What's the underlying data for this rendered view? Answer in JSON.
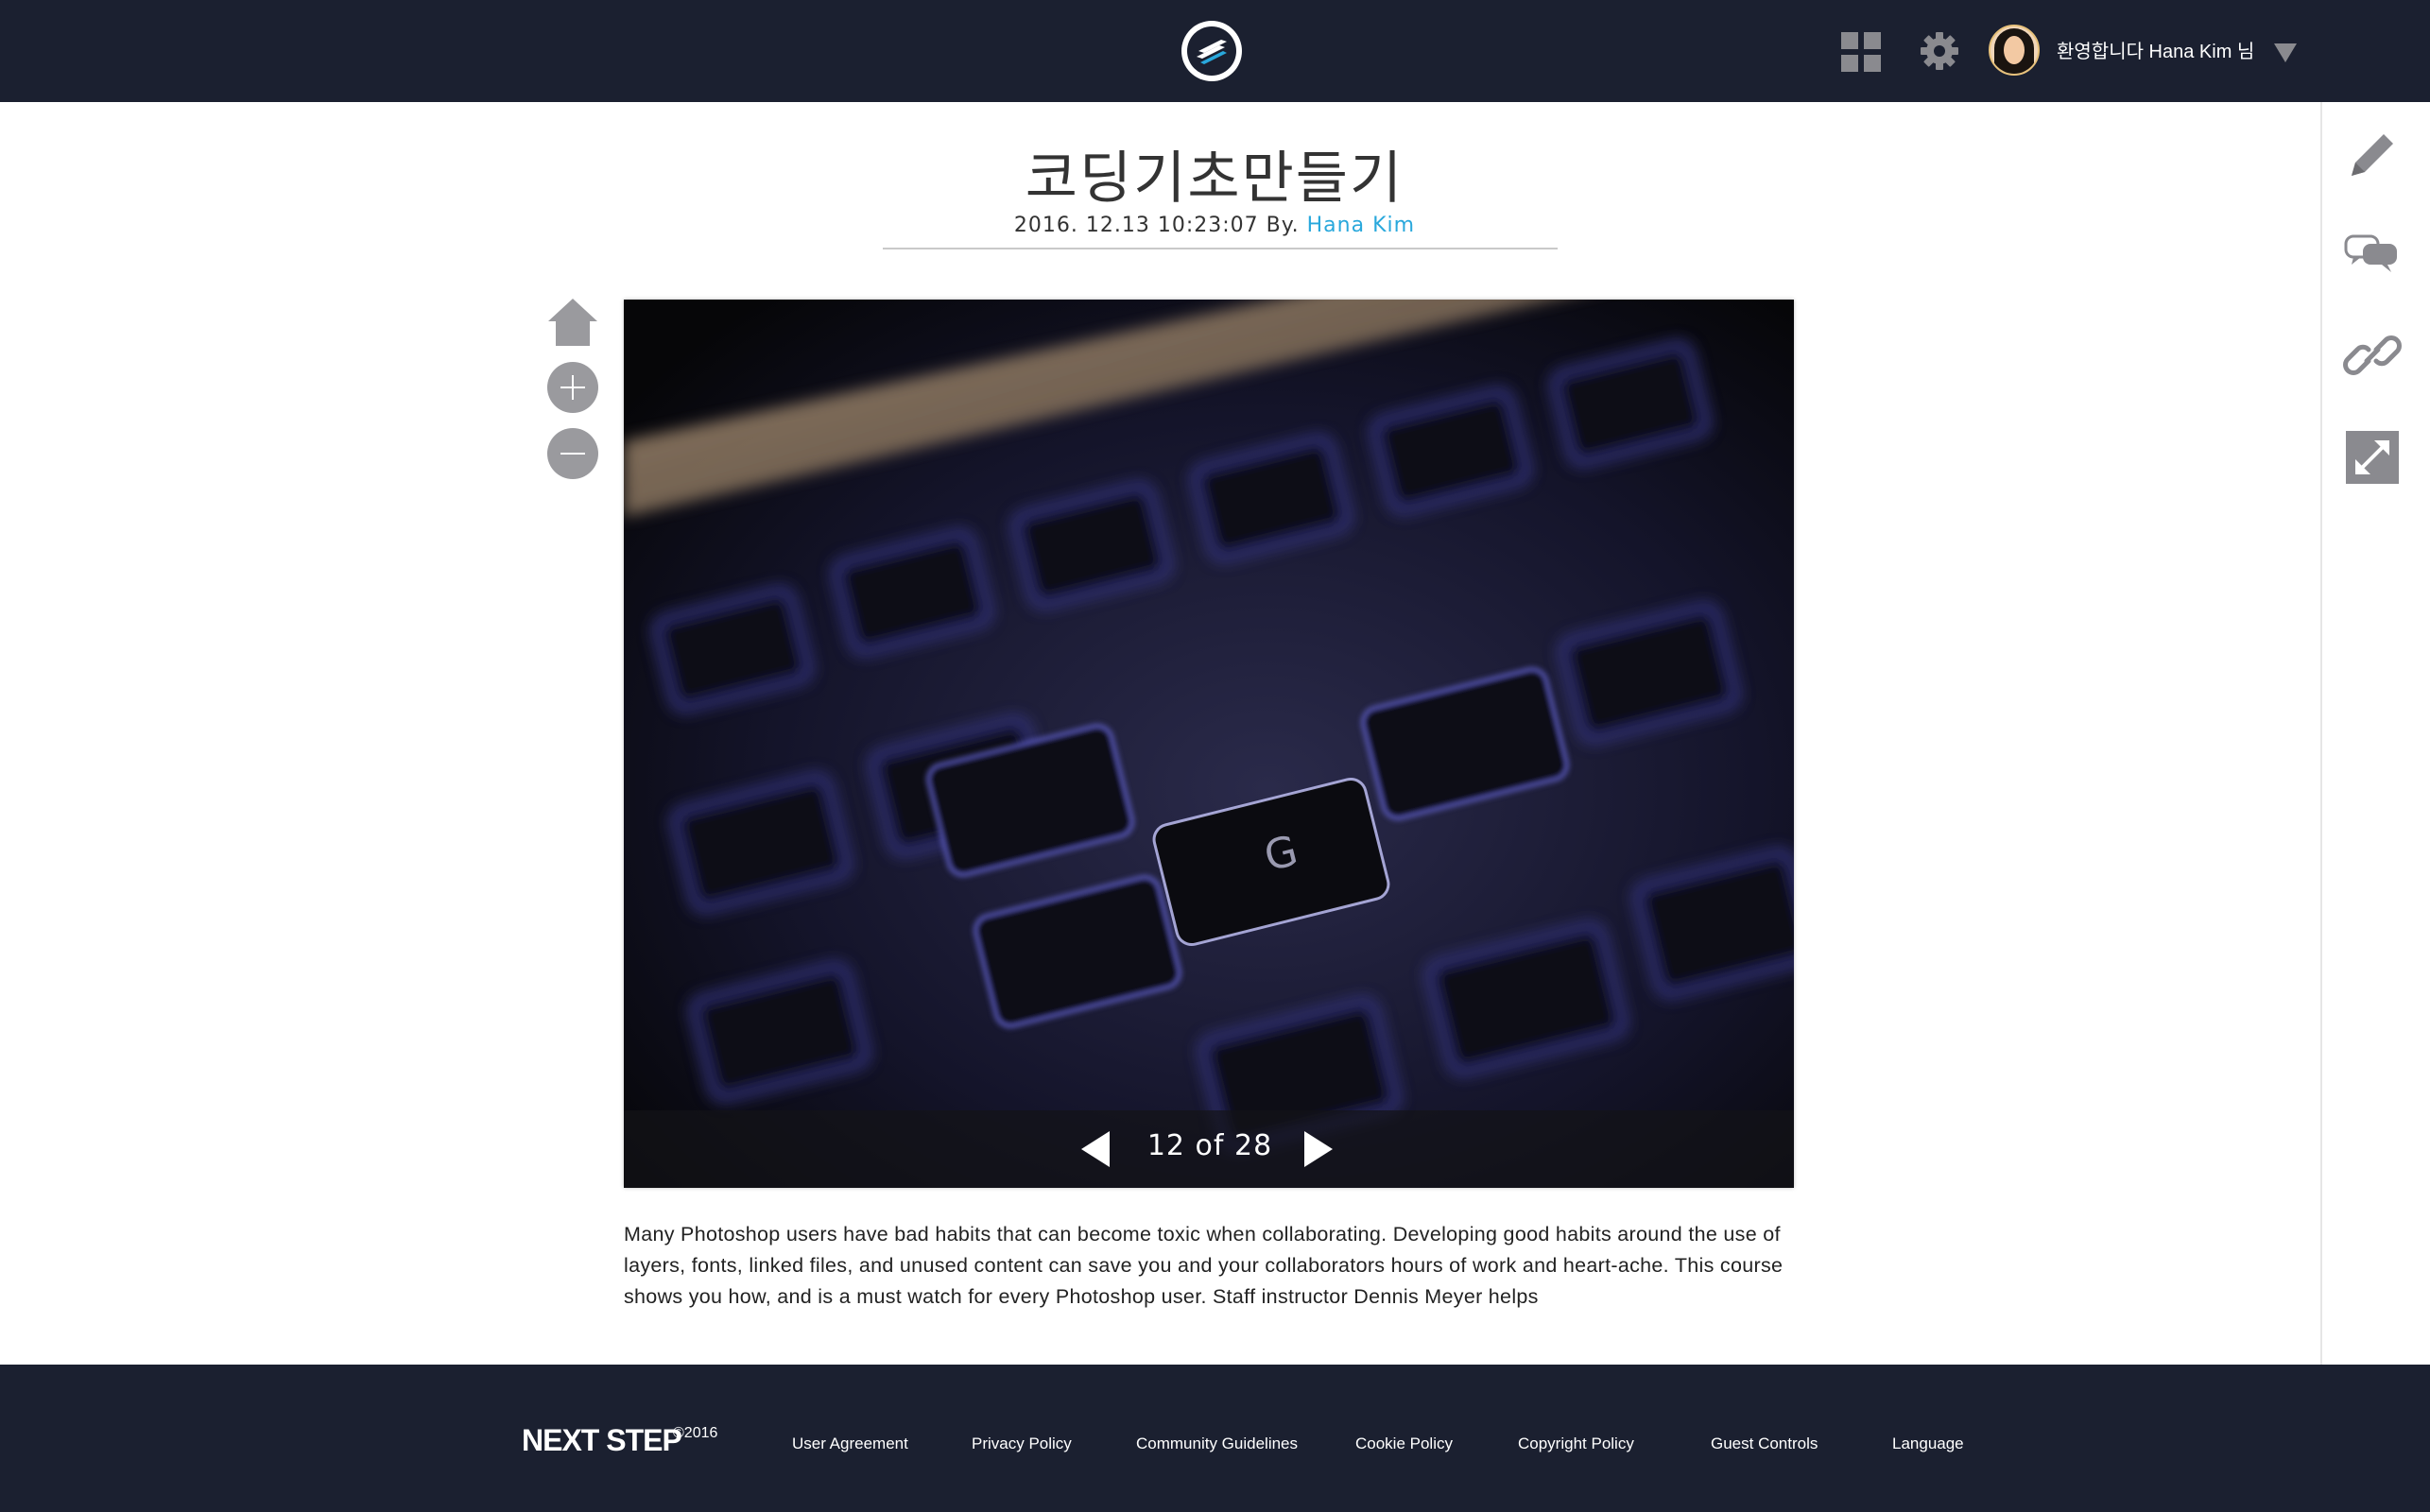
{
  "header": {
    "welcome_text": "환영합니다 Hana Kim 님"
  },
  "post": {
    "title": "코딩기초만들기",
    "date": "2016. 12.13  10:23:07 By.",
    "author": "Hana Kim",
    "description": "Many Photoshop users have bad habits that can become toxic when collaborating. Developing good habits around the use of layers, fonts, linked files, and unused content can save you and your collaborators hours of work and heart-ache. This course shows you how, and is a must watch for every Photoshop user. Staff instructor Dennis Meyer helps"
  },
  "viewer": {
    "current": 12,
    "total": 28,
    "counter_text": "12 of 28"
  },
  "footer": {
    "brand": "NEXT STEP",
    "year": "©2016",
    "links": [
      "User Agreement",
      "Privacy Policy",
      "Community Guidelines",
      "Cookie Policy",
      "Copyright Policy",
      "Guest Controls",
      "Language"
    ]
  },
  "icons": {
    "logo": "logo-icon",
    "apps": "apps-grid-icon",
    "settings": "gear-icon",
    "dropdown": "caret-down-icon",
    "home": "home-icon",
    "zoom_in": "zoom-in-icon",
    "zoom_out": "zoom-out-icon",
    "prev": "prev-arrow-icon",
    "next": "next-arrow-icon",
    "edit": "pencil-icon",
    "comment": "comment-icon",
    "link": "link-icon",
    "expand": "expand-icon"
  },
  "colors": {
    "topbar": "#1b2030",
    "accent": "#29a8dc",
    "icon_gray": "#8a8a8f"
  }
}
